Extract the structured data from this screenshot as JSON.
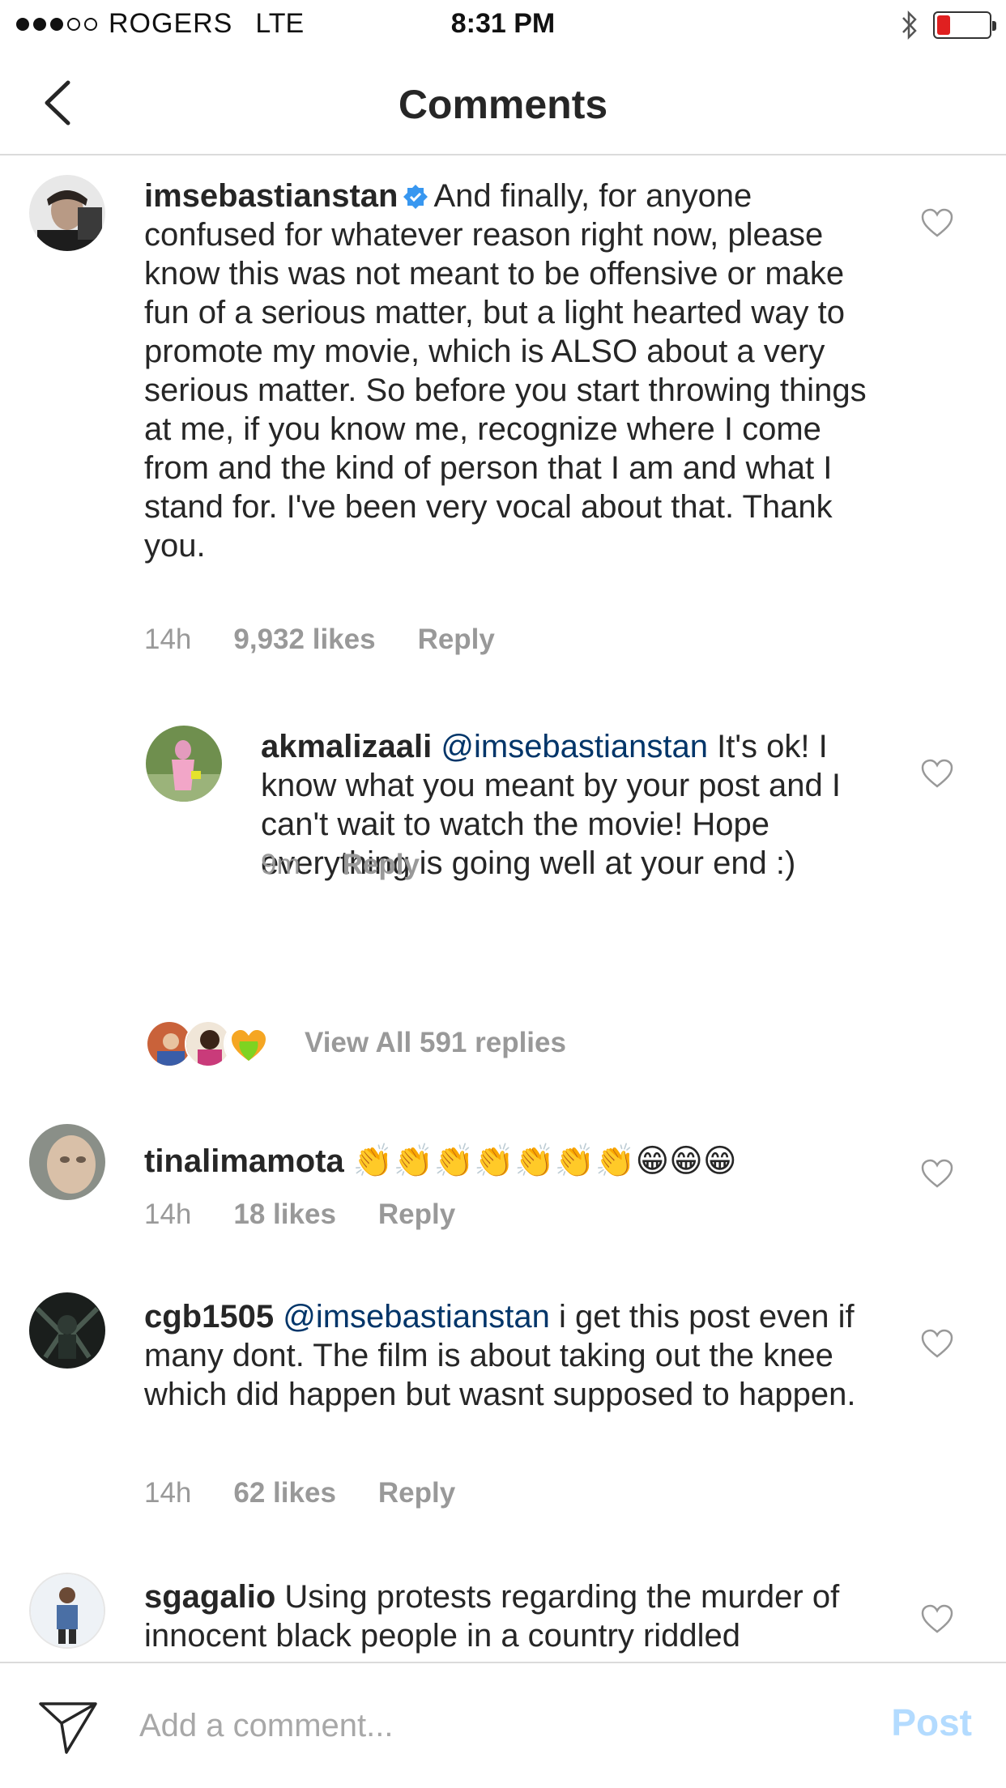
{
  "status_bar": {
    "carrier": "ROGERS",
    "network": "LTE",
    "time": "8:31 PM",
    "signal_bars_filled": 3,
    "signal_bars_total": 5,
    "battery_level": 0.15,
    "battery_color": "#e02020"
  },
  "header": {
    "title": "Comments",
    "back_icon": "chevron-left-icon"
  },
  "comments": [
    {
      "username": "imsebastianstan",
      "verified": true,
      "text": "And finally, for anyone confused for whatever reason right now, please know this was not meant to be offensive or make fun of a serious matter, but a light hearted way to promote my movie, which is ALSO about a very serious matter. So before you start throwing things at me, if you know me, recognize where I come from and the kind of person that I am and what I stand for. I've been very vocal about that. Thank you.",
      "time": "14h",
      "likes": "9,932 likes",
      "reply": "Reply"
    },
    {
      "username": "tinalimamota",
      "text": "👏👏👏👏👏👏👏😁😁😁",
      "time": "14h",
      "likes": "18 likes",
      "reply": "Reply"
    },
    {
      "username": "cgb1505",
      "mention": "@imsebastianstan",
      "text": "i get this post even if many dont.  The film is about taking out the knee which did happen but wasnt supposed to happen.",
      "time": "14h",
      "likes": "62 likes",
      "reply": "Reply"
    },
    {
      "username": "sgagalio",
      "text": "Using protests regarding the murder of innocent black people in a country riddled"
    }
  ],
  "reply": {
    "username": "akmalizaali",
    "mention": "@imsebastianstan",
    "text": "It's ok! I know what you meant by your post and I can't wait to watch the movie! Hope everything is going well at your end :)",
    "time": "9m",
    "reply": "Reply"
  },
  "view_replies": "View All 591 replies",
  "composer": {
    "placeholder": "Add a comment...",
    "post_label": "Post",
    "post_color": "#b3dbff"
  },
  "colors": {
    "text": "#262626",
    "meta": "#999999",
    "mention": "#003569",
    "verified": "#3897f0",
    "divider": "#dbdbdb"
  }
}
